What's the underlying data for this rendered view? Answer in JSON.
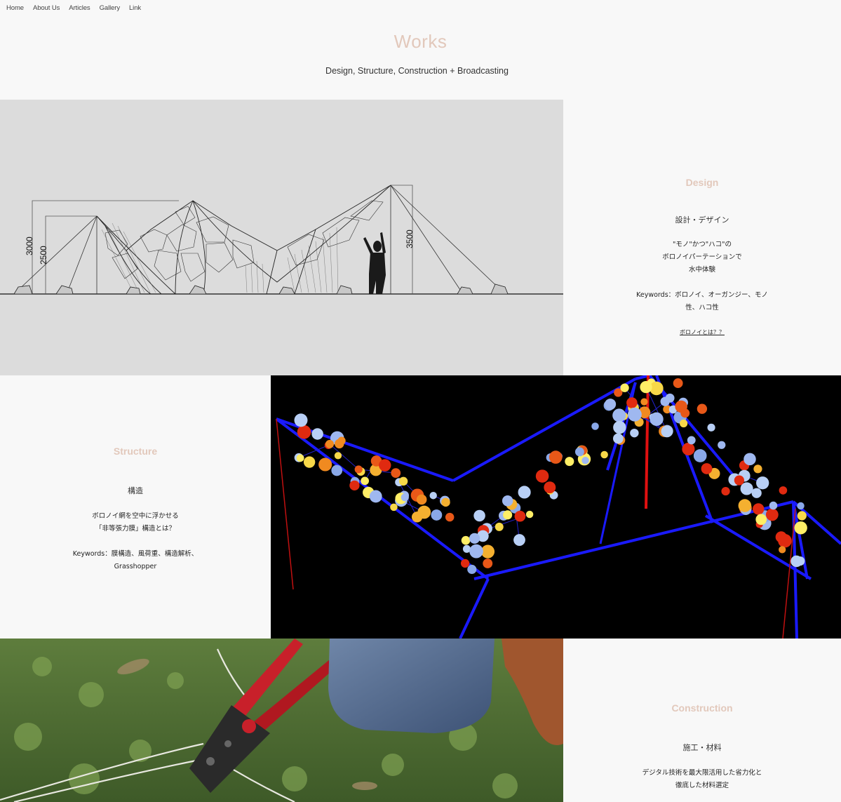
{
  "nav": {
    "items": [
      {
        "label": "Home"
      },
      {
        "label": "About Us"
      },
      {
        "label": "Articles"
      },
      {
        "label": "Gallery"
      },
      {
        "label": "Link"
      }
    ]
  },
  "header": {
    "title": "Works",
    "subtitle": "Design, Structure, Construction + Broadcasting"
  },
  "design": {
    "heading": "Design",
    "subheading": "設計・デザイン",
    "body": "\"モノ\"かつ\"ハコ\"の\nボロノイパーテーションで\n水中体験",
    "keywords": "Keywords：ボロノイ、オーガンジー、モノ\n性、ハコ性",
    "link": "ボロノイとは？？",
    "drawing": {
      "dim_3000": "3000",
      "dim_2500": "2500",
      "dim_3500": "3500"
    }
  },
  "structure": {
    "heading": "Structure",
    "subheading": "構造",
    "body": "ボロノイ網を空中に浮かせる\n「非等張力膜」構造とは？",
    "keywords": "Keywords：膜構造、風荷重、構造解析、\nGrasshopper"
  },
  "construction": {
    "heading": "Construction",
    "subheading": "施工・材料",
    "body": "デジタル技術を最大限活用した省力化と\n徹底した材料選定"
  },
  "colors": {
    "accent": "#e2c8bb",
    "background": "#f8f8f8",
    "drawing_bg": "#dcdcdc",
    "analysis_bg": "#000000"
  }
}
